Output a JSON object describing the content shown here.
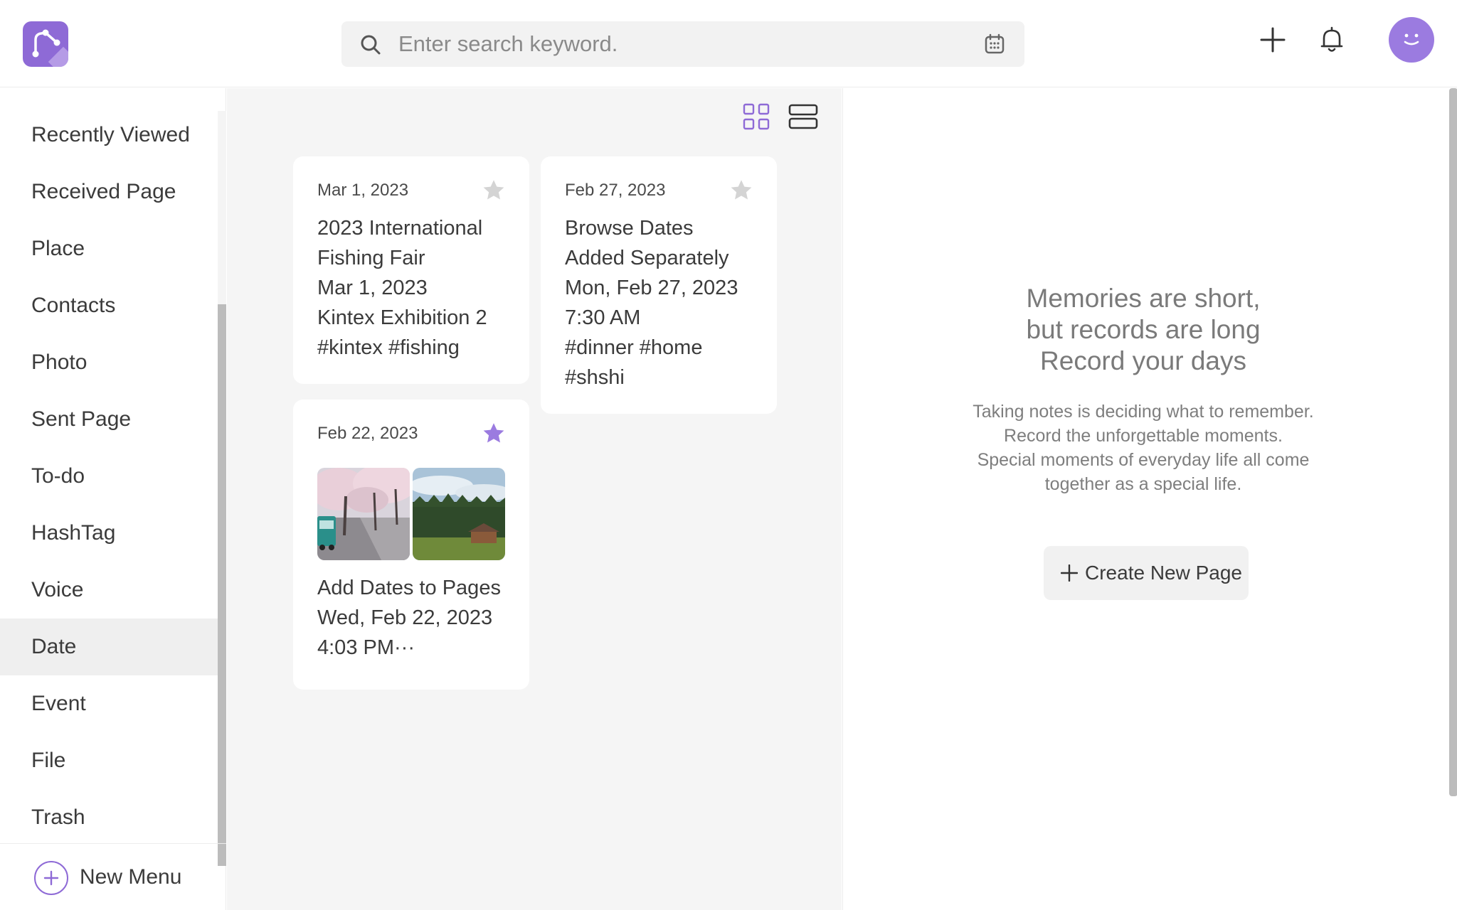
{
  "header": {
    "search": {
      "placeholder": "Enter search keyword."
    }
  },
  "sidebar": {
    "items": [
      {
        "label": "Recently Viewed"
      },
      {
        "label": "Received Page"
      },
      {
        "label": "Place"
      },
      {
        "label": "Contacts"
      },
      {
        "label": "Photo"
      },
      {
        "label": "Sent Page"
      },
      {
        "label": "To-do"
      },
      {
        "label": "HashTag"
      },
      {
        "label": "Voice"
      },
      {
        "label": "Date",
        "active": true
      },
      {
        "label": "Event"
      },
      {
        "label": "File"
      },
      {
        "label": "Trash"
      }
    ],
    "new_menu_label": "New Menu"
  },
  "main": {
    "cards": [
      {
        "date": "Mar 1, 2023",
        "starred": false,
        "body": "2023 International\nFishing Fair\nMar 1, 2023\nKintex Exhibition 2\n#kintex #fishing"
      },
      {
        "date": "Feb 27, 2023",
        "starred": false,
        "body": "Browse Dates\nAdded Separately\nMon, Feb 27, 2023\n7:30 AM\n#dinner #home\n#shshi"
      },
      {
        "date": "Feb 22, 2023",
        "starred": true,
        "body": "Add Dates to Pages\nWed, Feb 22, 2023\n4:03 PM···",
        "photos": [
          "cherry-blossom-road-photo",
          "forest-cabin-photo"
        ]
      }
    ]
  },
  "right_panel": {
    "title": "Memories are short,\nbut records are long\nRecord your days",
    "description": "Taking notes is deciding what to remember.\nRecord the unforgettable moments.\nSpecial moments of everyday life all come\ntogether as a special life.",
    "create_button_label": "Create New Page"
  },
  "colors": {
    "accent": "#8e6ad6",
    "star_active": "#9b7be0",
    "star_inactive": "#d4d4d4"
  }
}
